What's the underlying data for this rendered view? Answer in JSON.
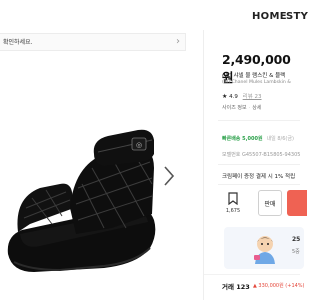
{
  "nav": {
    "home": "HOME",
    "style": "STY"
  },
  "notice": {
    "text": "확인하세요."
  },
  "product": {
    "price": "2,490,000원",
    "name_ko": "(W) 샤넬 물 램스킨 & 블랙",
    "name_en": "(W) Chanel Mules Lambskin &",
    "rating_value": "4.9",
    "review_count": "리뷰 23",
    "size_info": "사이즈 정보",
    "size_info_sep": "·",
    "size_info_extra": "상세",
    "delivery_tag": "빠른배송 5,000원",
    "delivery_extra": "내일 8/6(금)",
    "model_number": "모델번호 G45507-B15805-94305",
    "promo": "크림페이 증정 결제 시 1% 적립",
    "bookmark_count": "1,675",
    "sell_label": "판매"
  },
  "banner": {
    "line1": "25",
    "line2": "5중"
  },
  "trade": {
    "label": "거래 123",
    "change": "▲ 330,000원 (+14%)"
  },
  "colors": {
    "buy_button": "#ef6253",
    "delivery_green": "#2ca14b",
    "price_up_red": "#e4473b"
  },
  "icons": {
    "next": "chevron-right-icon",
    "bookmark": "bookmark-icon",
    "star": "star-icon",
    "notice_arrow": "chevron-right-icon"
  }
}
